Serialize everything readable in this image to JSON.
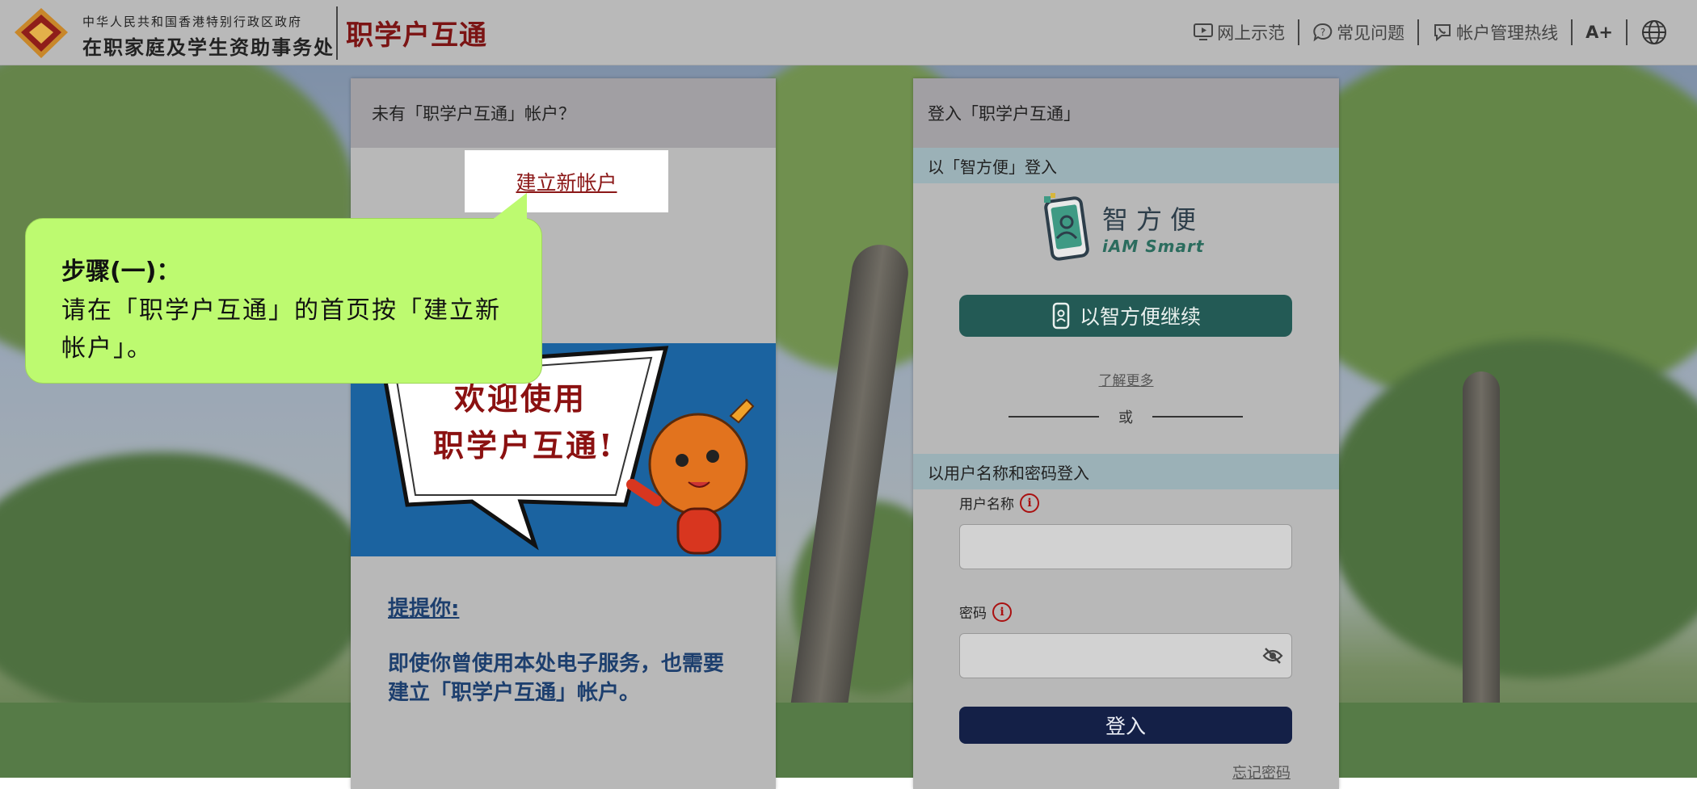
{
  "header": {
    "dept_line1": "中华人民共和国香港特别行政区政府",
    "dept_line2": "在职家庭及学生资助事务处",
    "brand": "职学户互通",
    "nav": [
      {
        "label": "网上示范",
        "icon": "video-demo-icon"
      },
      {
        "label": "常见问题",
        "icon": "faq-bubble-icon"
      },
      {
        "label": "帐户管理热线",
        "icon": "phone-hotline-icon"
      }
    ],
    "font_size_label": "A+",
    "language_icon": "globe-icon"
  },
  "left_card": {
    "heading": "未有「职学户互通」帐户？",
    "create_link": "建立新帐户",
    "banner_line1": "欢迎使用",
    "banner_line2": "职学户互通!",
    "reminder_title": "提提你:",
    "reminder_body": "即使你曾使用本处电子服务，也需要建立「职学户互通」帐户。"
  },
  "callout": {
    "step": "步骤(一)：",
    "text": "请在「职学户互通」的首页按「建立新帐户」。"
  },
  "right_card": {
    "heading": "登入「职学户互通」",
    "iam_section": "以「智方便」登入",
    "iam_logo_cn": "智方便",
    "iam_logo_en": "iAM Smart",
    "iam_button": "以智方便继续",
    "learn_more": "了解更多",
    "or": "或",
    "password_section": "以用户名称和密码登入",
    "username_label": "用户名称",
    "password_label": "密码",
    "login_button": "登入",
    "forgot_password": "忘记密码"
  },
  "colors": {
    "brand": "#7b1414",
    "iam_button": "#235a55",
    "login_button": "#142047",
    "callout": "#bdfa70"
  }
}
